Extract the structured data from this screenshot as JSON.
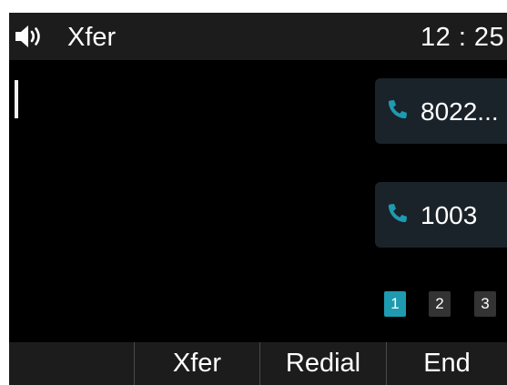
{
  "status_bar": {
    "title": "Xfer",
    "time": "12 : 25",
    "icon": "speaker-icon"
  },
  "calls": [
    {
      "number": "8022...",
      "icon": "phone-icon"
    },
    {
      "number": "1003",
      "icon": "phone-icon"
    }
  ],
  "pagination": {
    "pages": [
      "1",
      "2",
      "3"
    ],
    "active_page": "1"
  },
  "softkeys": [
    "",
    "Xfer",
    "Redial",
    "End"
  ],
  "colors": {
    "accent": "#1e9bb0",
    "card_background": "#1a2329",
    "bar_background": "#1c1c1c",
    "inactive_page": "#333333"
  }
}
